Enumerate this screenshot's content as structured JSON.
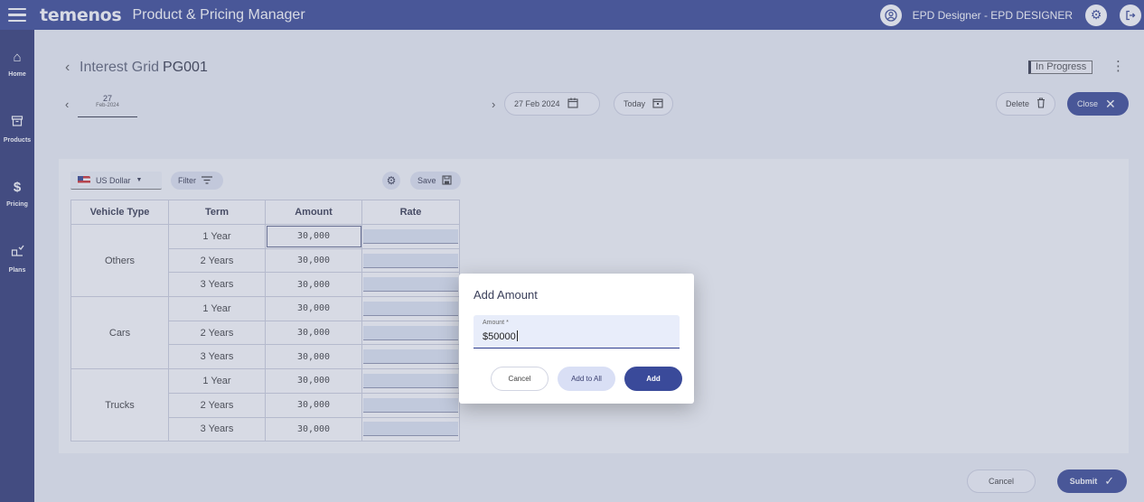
{
  "header": {
    "brand": "temenos",
    "app_title": "Product & Pricing Manager",
    "user": "EPD Designer - EPD DESIGNER"
  },
  "sidebar": {
    "items": [
      {
        "label": "Home",
        "icon": "home-icon"
      },
      {
        "label": "Products",
        "icon": "archive-box-icon"
      },
      {
        "label": "Pricing",
        "icon": "dollar-icon"
      },
      {
        "label": "Plans",
        "icon": "plans-icon"
      }
    ]
  },
  "page": {
    "title_prefix": "Interest Grid",
    "title_code": "PG001",
    "status": "In Progress",
    "date_tab_day": "27",
    "date_tab_month": "Feb-2024",
    "date_value": "27 Feb 2024",
    "today_label": "Today",
    "delete_label": "Delete",
    "close_label": "Close"
  },
  "grid_toolbar": {
    "currency": "US Dollar",
    "filter_label": "Filter",
    "save_label": "Save"
  },
  "grid": {
    "columns": [
      "Vehicle Type",
      "Term",
      "Amount",
      "Rate"
    ],
    "groups": [
      {
        "type": "Others",
        "rows": [
          {
            "term": "1 Year",
            "amount": "30,000"
          },
          {
            "term": "2 Years",
            "amount": "30,000"
          },
          {
            "term": "3 Years",
            "amount": "30,000"
          }
        ]
      },
      {
        "type": "Cars",
        "rows": [
          {
            "term": "1 Year",
            "amount": "30,000"
          },
          {
            "term": "2 Years",
            "amount": "30,000"
          },
          {
            "term": "3 Years",
            "amount": "30,000"
          }
        ]
      },
      {
        "type": "Trucks",
        "rows": [
          {
            "term": "1 Year",
            "amount": "30,000"
          },
          {
            "term": "2 Years",
            "amount": "30,000"
          },
          {
            "term": "3 Years",
            "amount": "30,000"
          }
        ]
      }
    ]
  },
  "footer": {
    "cancel_label": "Cancel",
    "submit_label": "Submit"
  },
  "modal": {
    "title": "Add Amount",
    "field_label": "Amount *",
    "currency_symbol": "$",
    "field_value": "50000",
    "cancel_label": "Cancel",
    "add_all_label": "Add to All",
    "add_label": "Add"
  },
  "colors": {
    "topbar": "#2f3e8f",
    "sidebar": "#262f6e",
    "primary_button": "#3a4a9a"
  }
}
